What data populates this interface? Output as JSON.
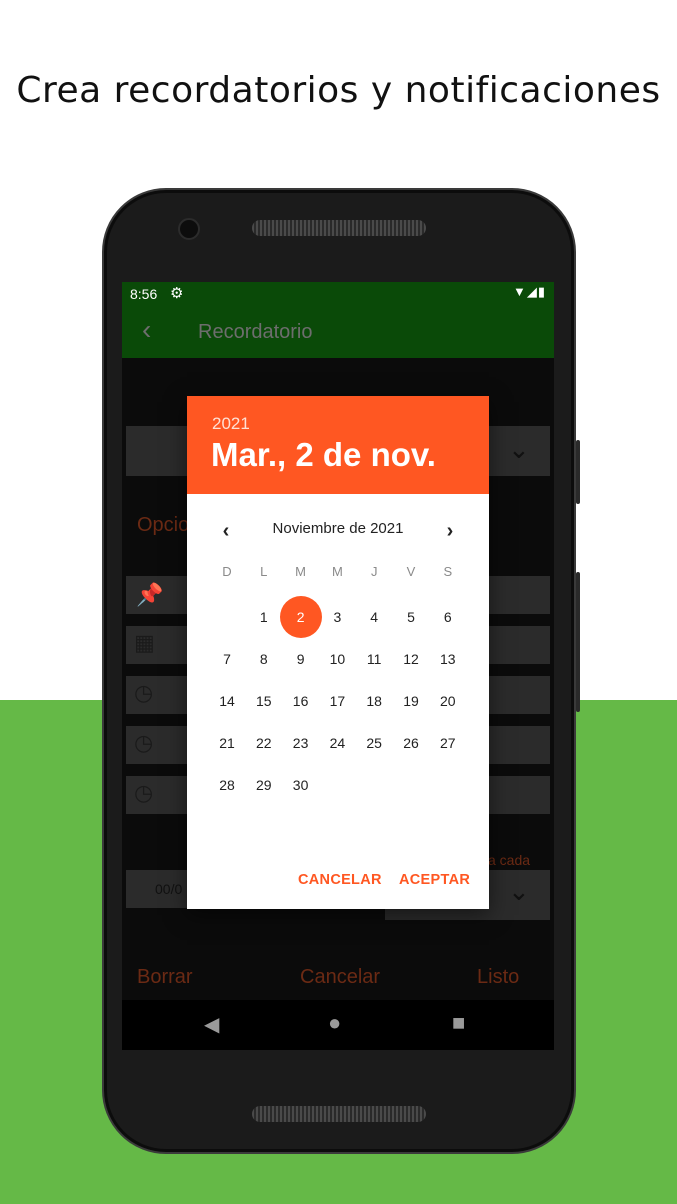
{
  "headline": "Crea recordatorios y notificaciones",
  "status": {
    "time": "8:56",
    "gear_icon": "gear-icon",
    "signal_icons": "wifi, cell, battery"
  },
  "appbar": {
    "title": "Recordatorio",
    "back_icon": "chevron-left-icon"
  },
  "background": {
    "options_text": "Opcio",
    "repeat_text": "a cada",
    "date_field": "00/0",
    "bottom_buttons": [
      "Borrar",
      "Cancelar",
      "Listo"
    ]
  },
  "dialog": {
    "year": "2021",
    "date": "Mar., 2 de nov.",
    "month": "Noviembre de 2021",
    "weekdays": [
      "D",
      "L",
      "M",
      "M",
      "J",
      "V",
      "S"
    ],
    "days": [
      "1",
      "2",
      "3",
      "4",
      "5",
      "6",
      "7",
      "8",
      "9",
      "10",
      "11",
      "12",
      "13",
      "14",
      "15",
      "16",
      "17",
      "18",
      "19",
      "20",
      "21",
      "22",
      "23",
      "24",
      "25",
      "26",
      "27",
      "28",
      "29",
      "30"
    ],
    "first_day_offset": 1,
    "selected_day": "2",
    "cancel_label": "CANCELAR",
    "accept_label": "ACEPTAR"
  },
  "colors": {
    "accent": "#ff5722",
    "appbar": "#0a4a08",
    "band": "#65b947"
  }
}
